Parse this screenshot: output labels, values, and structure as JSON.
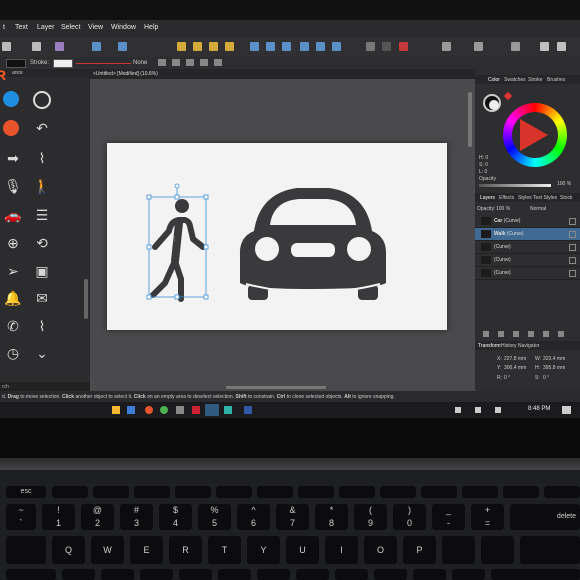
{
  "menu": [
    "t",
    "Text",
    "Layer",
    "Select",
    "View",
    "Window",
    "Help"
  ],
  "context_bar": {
    "stroke_label": "Stroke:",
    "none_label": "None"
  },
  "left_panel": {
    "tab_label": "ance",
    "search_label": "rch"
  },
  "document_tab": "<Untitled> [Modified] (10.6%)",
  "right_panel": {
    "tabs": [
      "Color",
      "Swatches",
      "Stroke",
      "Brushes"
    ],
    "color_values": [
      "H: 0",
      "S: 0",
      "L: 0"
    ],
    "opacity_label": "Opacity",
    "opacity_value": "100 %",
    "layer_tabs": [
      "Layers",
      "Effects",
      "Styles",
      "Text Styles",
      "Stock"
    ],
    "layer_opacity_label": "Opacity:",
    "layer_opacity_value": "100 %",
    "blend_mode": "Normal",
    "layers": [
      {
        "name": "Car",
        "type": "(Curve)",
        "selected": false
      },
      {
        "name": "Walk",
        "type": "(Curve)",
        "selected": true
      },
      {
        "name": "",
        "type": "(Curve)",
        "selected": false
      },
      {
        "name": "",
        "type": "(Curve)",
        "selected": false
      },
      {
        "name": "",
        "type": "(Curve)",
        "selected": false
      }
    ],
    "transform_tabs": [
      "Transform",
      "History",
      "Navigator"
    ],
    "transform": {
      "x": "227.8 mm",
      "y": "300.4 mm",
      "w": "323.4 mm",
      "h": "395.8 mm",
      "r": "0 °",
      "s": "0 °",
      "x_label": "X:",
      "y_label": "Y:",
      "w_label": "W:",
      "h_label": "H:",
      "r_label": "R:",
      "s_label": "S:"
    }
  },
  "status_bar": {
    "parts": [
      {
        "text": "d. ",
        "bold": false
      },
      {
        "text": "Drag",
        "bold": true
      },
      {
        "text": " to move selection. ",
        "bold": false
      },
      {
        "text": "Click",
        "bold": true
      },
      {
        "text": " another object to select it. ",
        "bold": false
      },
      {
        "text": "Click",
        "bold": true
      },
      {
        "text": " on an empty area to deselect selection. ",
        "bold": false
      },
      {
        "text": "Shift",
        "bold": true
      },
      {
        "text": " to constrain. ",
        "bold": false
      },
      {
        "text": "Ctrl",
        "bold": true
      },
      {
        "text": " to clone selected objects. ",
        "bold": false
      },
      {
        "text": "Alt",
        "bold": true
      },
      {
        "text": " to ignore snapping.",
        "bold": false
      }
    ]
  },
  "taskbar": {
    "time": "8:48 PM"
  },
  "keyboard": {
    "row_top": [
      "esc",
      "",
      "",
      "",
      "",
      "",
      "",
      "",
      "",
      "",
      "",
      "",
      ""
    ],
    "row_num": [
      "~",
      "!",
      "@",
      "#",
      "$",
      "%",
      "^",
      "&",
      "*",
      "(",
      ")",
      "_",
      "+"
    ],
    "row_num_lower": [
      "`",
      "1",
      "2",
      "3",
      "4",
      "5",
      "6",
      "7",
      "8",
      "9",
      "0",
      "-",
      "="
    ],
    "row_q": [
      "Q",
      "W",
      "E",
      "R",
      "T",
      "Y",
      "U",
      "I",
      "O",
      "P"
    ],
    "delete_label": "delete"
  },
  "colors": {
    "accent": "#3f6b93",
    "app_bg": "#2c2c2e",
    "artboard": "#f3f3f3",
    "icon_fill": "#3a3a3c"
  }
}
